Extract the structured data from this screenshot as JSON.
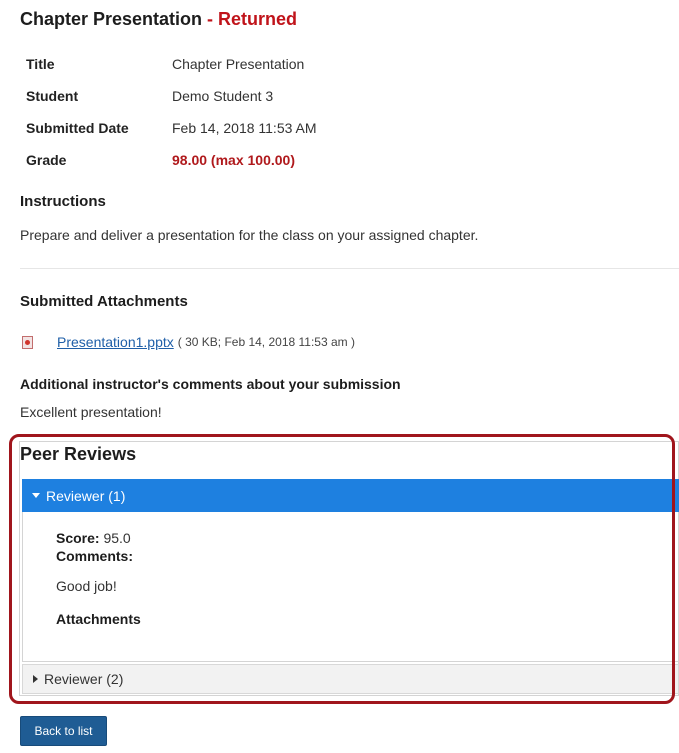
{
  "header": {
    "title": "Chapter Presentation",
    "separator": " - ",
    "status": "Returned"
  },
  "details": {
    "title_label": "Title",
    "title_value": "Chapter Presentation",
    "student_label": "Student",
    "student_value": "Demo Student 3",
    "submitted_label": "Submitted Date",
    "submitted_value": "Feb 14, 2018 11:53 AM",
    "grade_label": "Grade",
    "grade_value": "98.00 (max 100.00)"
  },
  "instructions": {
    "heading": "Instructions",
    "text": "Prepare and deliver a presentation for the class on your assigned chapter."
  },
  "attachments": {
    "heading": "Submitted Attachments",
    "file_icon": "powerpoint-file-icon",
    "file_name": "Presentation1.pptx",
    "file_meta": "( 30 KB; Feb 14, 2018 11:53 am )"
  },
  "instructor_comments": {
    "heading": "Additional instructor's comments about your submission",
    "text": "Excellent presentation!"
  },
  "peer_reviews": {
    "heading": "Peer Reviews",
    "reviewer1": {
      "label": "Reviewer (1)",
      "score_label": "Score:",
      "score_value": "95.0",
      "comments_label": "Comments:",
      "comments_text": "Good job!",
      "attachments_label": "Attachments"
    },
    "reviewer2": {
      "label": "Reviewer (2)"
    }
  },
  "actions": {
    "back_label": "Back to list"
  },
  "colors": {
    "status": "#c0131a",
    "highlight": "#a0151c",
    "reviewer_bar": "#1e80e0",
    "button": "#1f5c94"
  }
}
